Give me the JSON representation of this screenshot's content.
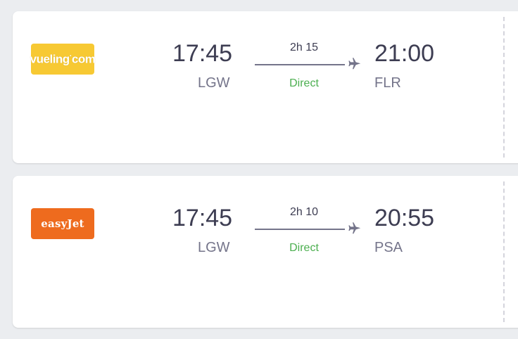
{
  "flights": [
    {
      "airline": "vueling",
      "logo_text_main": "vueling",
      "logo_text_suffix": "com",
      "logo_color": "#f7c933",
      "departure_time": "17:45",
      "departure_airport": "LGW",
      "duration": "2h 15",
      "stops": "Direct",
      "arrival_time": "21:00",
      "arrival_airport": "FLR"
    },
    {
      "airline": "easyjet",
      "logo_text_main": "easyJet",
      "logo_color": "#ee6b1e",
      "departure_time": "17:45",
      "departure_airport": "LGW",
      "duration": "2h 10",
      "stops": "Direct",
      "arrival_time": "20:55",
      "arrival_airport": "PSA"
    }
  ],
  "colors": {
    "page_background": "#ebedf0",
    "card_background": "#ffffff",
    "time_text": "#3d3d52",
    "code_text": "#74748a",
    "direct_text": "#4caf50"
  },
  "icons": {
    "plane": "plane-icon"
  }
}
